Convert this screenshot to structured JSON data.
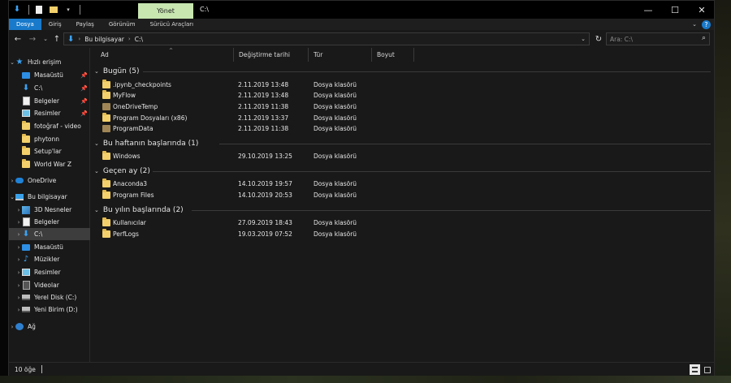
{
  "titlebar": {
    "manage_tab": "Yönet",
    "path_title": "C:\\",
    "minimize": "—",
    "maximize": "☐",
    "close": "✕"
  },
  "ribbon": {
    "tabs": [
      "Dosya",
      "Giriş",
      "Paylaş",
      "Görünüm",
      "Sürücü Araçları"
    ],
    "active_tab": "Dosya",
    "help": "?"
  },
  "address": {
    "crumbs": [
      "Bu bilgisayar",
      "C:\\"
    ],
    "search_placeholder": "Ara: C:\\"
  },
  "sidebar": {
    "items": [
      {
        "label": "Hızlı erişim",
        "icon": "star-icon"
      },
      {
        "label": "Masaüstü",
        "icon": "desktop-icon",
        "pinned": true
      },
      {
        "label": "C:\\",
        "icon": "download-icon",
        "pinned": true
      },
      {
        "label": "Belgeler",
        "icon": "document-icon",
        "pinned": true
      },
      {
        "label": "Resimler",
        "icon": "pictures-icon",
        "pinned": true
      },
      {
        "label": "fotoğraf - video",
        "icon": "folder-icon"
      },
      {
        "label": "phytonn",
        "icon": "folder-icon"
      },
      {
        "label": "Setup'lar",
        "icon": "folder-icon"
      },
      {
        "label": "World War Z",
        "icon": "folder-icon"
      },
      {
        "label": "OneDrive",
        "icon": "cloud-icon"
      },
      {
        "label": "Bu bilgisayar",
        "icon": "computer-icon"
      },
      {
        "label": "3D Nesneler",
        "icon": "cube-icon"
      },
      {
        "label": "Belgeler",
        "icon": "document-icon"
      },
      {
        "label": "C:\\",
        "icon": "download-icon"
      },
      {
        "label": "Masaüstü",
        "icon": "desktop-icon"
      },
      {
        "label": "Müzikler",
        "icon": "music-icon"
      },
      {
        "label": "Resimler",
        "icon": "pictures-icon"
      },
      {
        "label": "Videolar",
        "icon": "video-icon"
      },
      {
        "label": "Yerel Disk (C:)",
        "icon": "drive-icon"
      },
      {
        "label": "Yeni Birim (D:)",
        "icon": "drive-icon"
      },
      {
        "label": "Ağ",
        "icon": "network-icon"
      }
    ]
  },
  "columns": [
    "Ad",
    "Değiştirme tarihi",
    "Tür",
    "Boyut"
  ],
  "groups": [
    {
      "name": "Bugün (5)",
      "files": [
        {
          "name": ".ipynb_checkpoints",
          "date": "2.11.2019 13:48",
          "type": "Dosya klasörü"
        },
        {
          "name": "MyFlow",
          "date": "2.11.2019 13:48",
          "type": "Dosya klasörü"
        },
        {
          "name": "OneDriveTemp",
          "date": "2.11.2019 11:38",
          "type": "Dosya klasörü"
        },
        {
          "name": "Program Dosyaları (x86)",
          "date": "2.11.2019 13:37",
          "type": "Dosya klasörü"
        },
        {
          "name": "ProgramData",
          "date": "2.11.2019 11:38",
          "type": "Dosya klasörü"
        }
      ]
    },
    {
      "name": "Bu haftanın başlarında (1)",
      "files": [
        {
          "name": "Windows",
          "date": "29.10.2019 13:25",
          "type": "Dosya klasörü"
        }
      ]
    },
    {
      "name": "Geçen ay (2)",
      "files": [
        {
          "name": "Anaconda3",
          "date": "14.10.2019 19:57",
          "type": "Dosya klasörü"
        },
        {
          "name": "Program Files",
          "date": "14.10.2019 20:53",
          "type": "Dosya klasörü"
        }
      ]
    },
    {
      "name": "Bu yılın başlarında (2)",
      "files": [
        {
          "name": "Kullanıcılar",
          "date": "27.09.2019 18:43",
          "type": "Dosya klasörü"
        },
        {
          "name": "PerfLogs",
          "date": "19.03.2019 07:52",
          "type": "Dosya klasörü"
        }
      ]
    }
  ],
  "status": {
    "item_count": "10 öğe"
  }
}
